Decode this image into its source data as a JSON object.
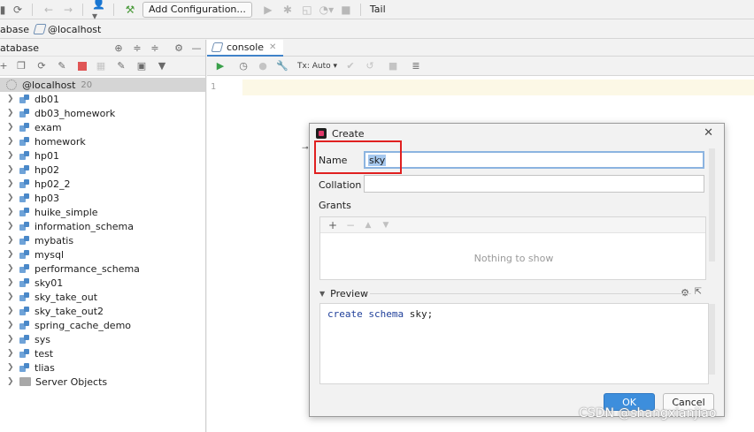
{
  "toolbar": {
    "add_configuration_label": "Add Configuration...",
    "tail_label": "Tail"
  },
  "breadcrumb": {
    "items": [
      "abase",
      "@localhost"
    ]
  },
  "left_panel": {
    "title": "atabase",
    "root": {
      "label": "@localhost",
      "count": "20"
    },
    "items": [
      "db01",
      "db03_homework",
      "exam",
      "homework",
      "hp01",
      "hp02",
      "hp02_2",
      "hp03",
      "huike_simple",
      "information_schema",
      "mybatis",
      "mysql",
      "performance_schema",
      "sky01",
      "sky_take_out",
      "sky_take_out2",
      "spring_cache_demo",
      "sys",
      "test",
      "tlias"
    ],
    "server_objects": "Server Objects"
  },
  "editor": {
    "tab_label": "console",
    "tx_label": "Tx: Auto",
    "line_number": "1"
  },
  "dialog": {
    "title": "Create",
    "name_label": "Name",
    "name_value": "sky",
    "collation_label": "Collation",
    "grants_label": "Grants",
    "nothing_to_show": "Nothing to show",
    "preview_label": "Preview",
    "preview_keyword": "create schema",
    "preview_rest": " sky;",
    "ok_label": "OK",
    "cancel_label": "Cancel"
  },
  "watermark": "CSDN @shangxianjiao",
  "colors": {
    "accent": "#3d8edc",
    "highlight_box": "#e02020",
    "keyword": "#1f3f9a"
  }
}
